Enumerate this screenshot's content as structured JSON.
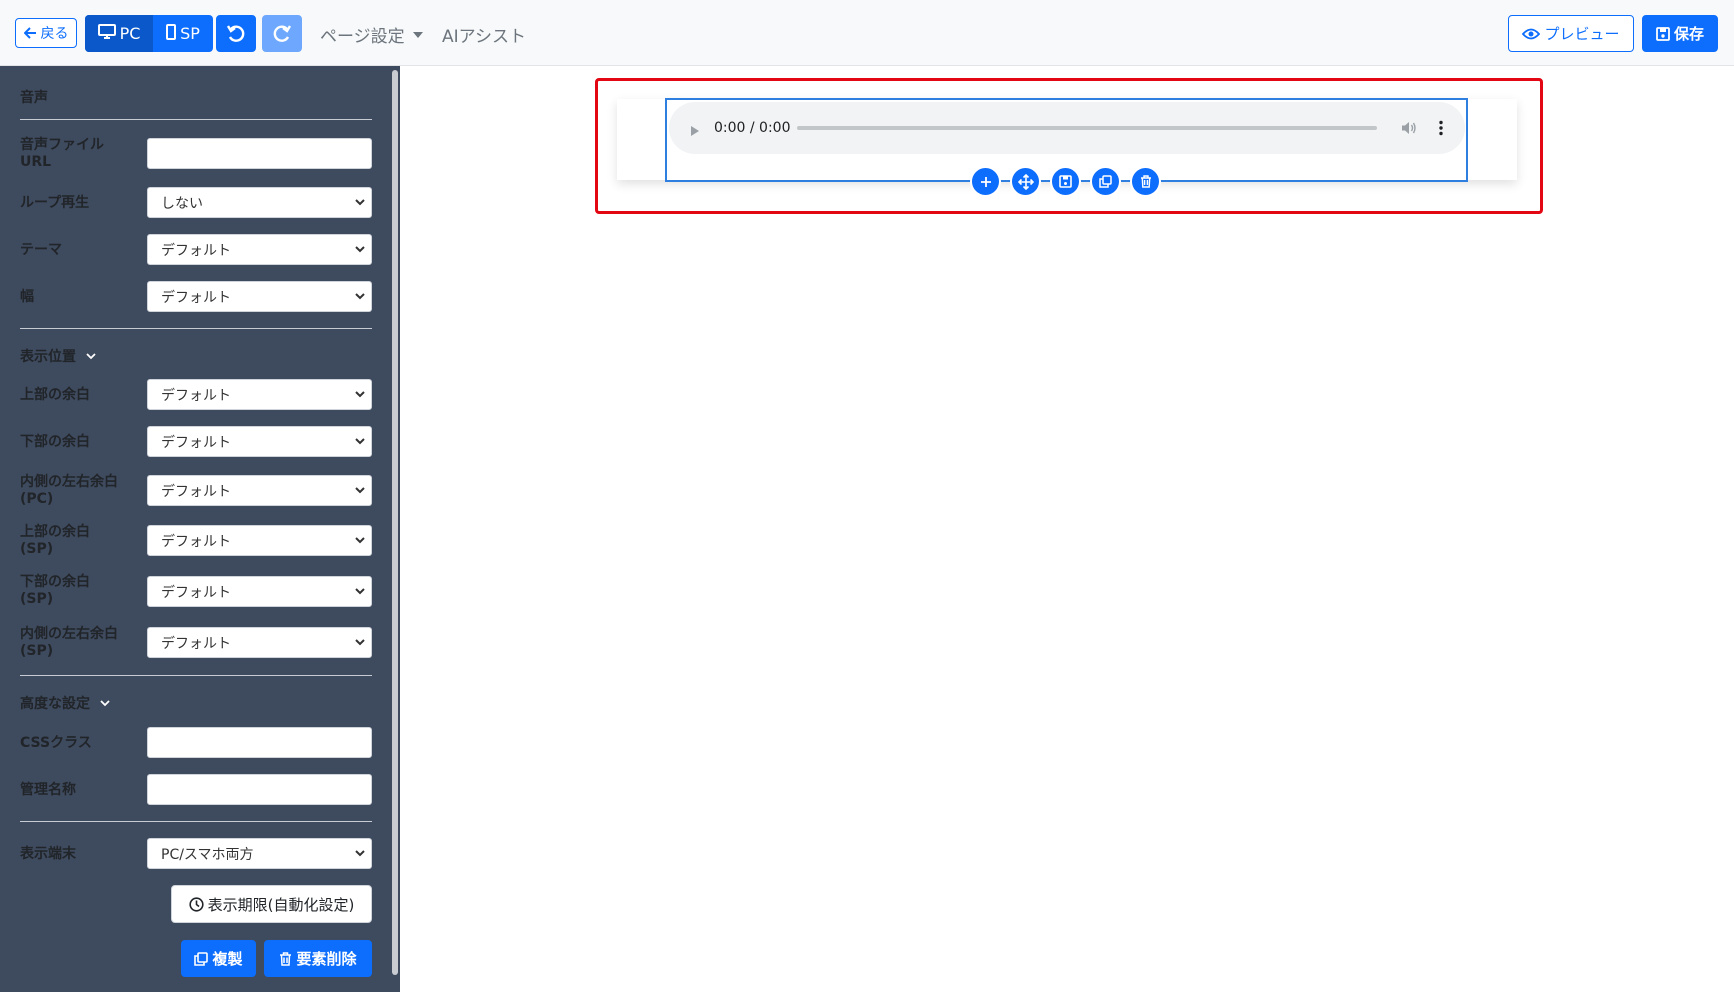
{
  "toolbar": {
    "back_label": "戻る",
    "pc_label": "PC",
    "sp_label": "SP",
    "page_settings_label": "ページ設定",
    "ai_assist_label": "AIアシスト",
    "preview_label": "プレビュー",
    "save_label": "保存"
  },
  "sidebar": {
    "section_title": "音声",
    "audio_url_label": "音声ファイルURL",
    "audio_url_value": "",
    "loop_label": "ループ再生",
    "loop_value": "しない",
    "theme_label": "テーマ",
    "theme_value": "デフォルト",
    "width_label": "幅",
    "width_value": "デフォルト",
    "position_section": "表示位置",
    "margin_top_label": "上部の余白",
    "margin_top_value": "デフォルト",
    "margin_bottom_label": "下部の余白",
    "margin_bottom_value": "デフォルト",
    "padding_pc_label": "内側の左右余白(PC)",
    "padding_pc_value": "デフォルト",
    "margin_top_sp_label": "上部の余白(SP)",
    "margin_top_sp_value": "デフォルト",
    "margin_bottom_sp_label": "下部の余白(SP)",
    "margin_bottom_sp_value": "デフォルト",
    "padding_sp_label": "内側の左右余白(SP)",
    "padding_sp_value": "デフォルト",
    "advanced_section": "高度な設定",
    "css_class_label": "CSSクラス",
    "css_class_value": "",
    "admin_name_label": "管理名称",
    "admin_name_value": "",
    "device_label": "表示端末",
    "device_value": "PC/スマホ両方",
    "schedule_button": "表示期限(自動化設定)",
    "duplicate_button": "複製",
    "delete_button": "要素削除"
  },
  "canvas": {
    "audio_time": "0:00 / 0:00"
  },
  "colors": {
    "primary": "#0d6efd",
    "sidebar_bg": "#3e4a5e",
    "highlight": "#e30613"
  }
}
